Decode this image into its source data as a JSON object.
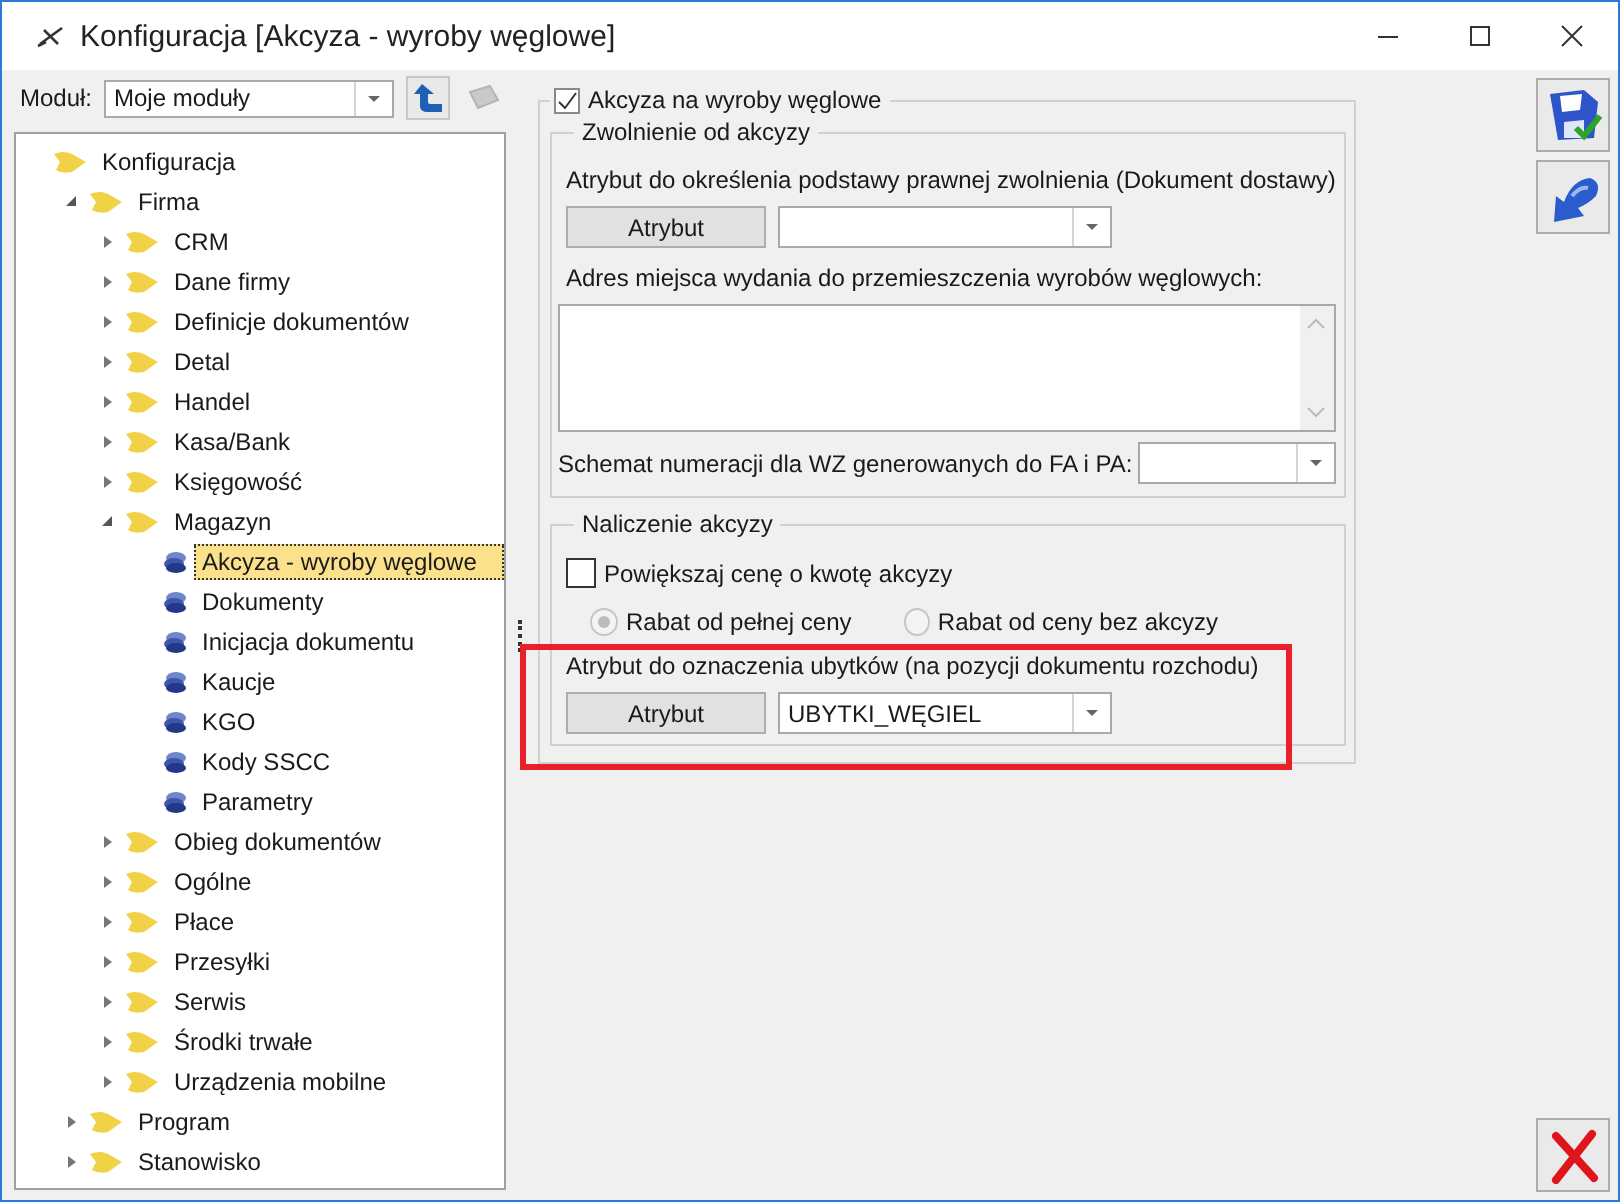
{
  "window": {
    "title": "Konfiguracja [Akcyza - wyroby węglowe]"
  },
  "module": {
    "label": "Moduł:",
    "value": "Moje moduły"
  },
  "tree": [
    {
      "label": "Konfiguracja",
      "kind": "folder",
      "selected": false,
      "children": [
        {
          "label": "Firma",
          "kind": "folder",
          "expanded": true,
          "selected": false,
          "children": [
            {
              "label": "CRM",
              "kind": "folder",
              "expanded": false,
              "selected": false
            },
            {
              "label": "Dane firmy",
              "kind": "folder",
              "expanded": false,
              "selected": false
            },
            {
              "label": "Definicje dokumentów",
              "kind": "folder",
              "expanded": false,
              "selected": false
            },
            {
              "label": "Detal",
              "kind": "folder",
              "expanded": false,
              "selected": false
            },
            {
              "label": "Handel",
              "kind": "folder",
              "expanded": false,
              "selected": false
            },
            {
              "label": "Kasa/Bank",
              "kind": "folder",
              "expanded": false,
              "selected": false
            },
            {
              "label": "Księgowość",
              "kind": "folder",
              "expanded": false,
              "selected": false
            },
            {
              "label": "Magazyn",
              "kind": "folder",
              "expanded": true,
              "selected": false,
              "children": [
                {
                  "label": "Akcyza - wyroby węglowe",
                  "kind": "leaf",
                  "selected": true
                },
                {
                  "label": "Dokumenty",
                  "kind": "leaf",
                  "selected": false
                },
                {
                  "label": "Inicjacja dokumentu",
                  "kind": "leaf",
                  "selected": false
                },
                {
                  "label": "Kaucje",
                  "kind": "leaf",
                  "selected": false
                },
                {
                  "label": "KGO",
                  "kind": "leaf",
                  "selected": false
                },
                {
                  "label": "Kody SSCC",
                  "kind": "leaf",
                  "selected": false
                },
                {
                  "label": "Parametry",
                  "kind": "leaf",
                  "selected": false
                }
              ]
            },
            {
              "label": "Obieg dokumentów",
              "kind": "folder",
              "expanded": false,
              "selected": false
            },
            {
              "label": "Ogólne",
              "kind": "folder",
              "expanded": false,
              "selected": false
            },
            {
              "label": "Płace",
              "kind": "folder",
              "expanded": false,
              "selected": false
            },
            {
              "label": "Przesyłki",
              "kind": "folder",
              "expanded": false,
              "selected": false
            },
            {
              "label": "Serwis",
              "kind": "folder",
              "expanded": false,
              "selected": false
            },
            {
              "label": "Środki trwałe",
              "kind": "folder",
              "expanded": false,
              "selected": false
            },
            {
              "label": "Urządzenia mobilne",
              "kind": "folder",
              "expanded": false,
              "selected": false
            }
          ]
        },
        {
          "label": "Program",
          "kind": "folder",
          "expanded": false,
          "selected": false
        },
        {
          "label": "Stanowisko",
          "kind": "folder",
          "expanded": false,
          "selected": false
        }
      ]
    }
  ],
  "excise": {
    "label": "Akcyza na wyroby węglowe",
    "checked": true,
    "exemption": {
      "title": "Zwolnienie od akcyzy",
      "attribute_label": "Atrybut do określenia podstawy prawnej zwolnienia (Dokument dostawy)",
      "attribute_button": "Atrybut",
      "address_label": "Adres miejsca wydania do przemieszczenia wyrobów węglowych:",
      "numbering_label": "Schemat numeracji dla WZ generowanych do FA i PA:"
    },
    "calculation": {
      "title": "Naliczenie akcyzy",
      "increase_price": {
        "label": "Powiększaj cenę o kwotę akcyzy",
        "checked": false
      },
      "discount_options": [
        {
          "label": "Rabat od pełnej ceny",
          "selected": true,
          "disabled": true
        },
        {
          "label": "Rabat od ceny bez akcyzy",
          "selected": false,
          "disabled": true
        }
      ],
      "loss_attribute_label": "Atrybut do oznaczenia ubytków (na pozycji dokumentu rozchodu)",
      "loss_attribute_button": "Atrybut",
      "loss_attribute_value": "UBYTKI_WĘGIEL",
      "highlighted": true
    }
  }
}
